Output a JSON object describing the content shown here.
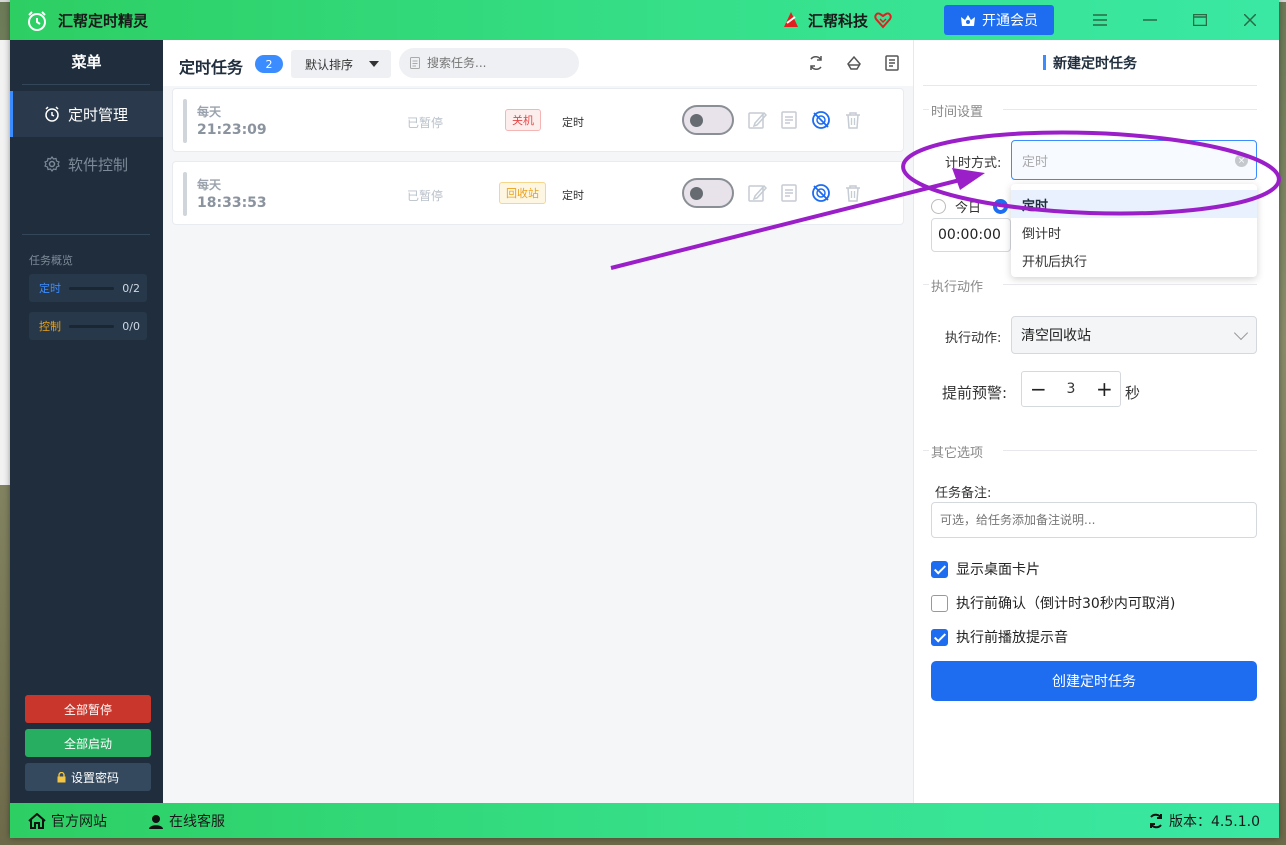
{
  "app": {
    "title": "汇帮定时精灵",
    "brand": "汇帮科技",
    "vip_button": "开通会员"
  },
  "sidebar": {
    "menu_title": "菜单",
    "items": [
      {
        "label": "定时管理",
        "icon": "alarm-clock-icon",
        "active": true
      },
      {
        "label": "软件控制",
        "icon": "gear-icon",
        "active": false
      }
    ],
    "overview_title": "任务概览",
    "overview": [
      {
        "label": "定时",
        "count": "0/2",
        "color": "#3b8cff"
      },
      {
        "label": "控制",
        "count": "0/0",
        "color": "#e9a11a"
      }
    ],
    "buttons": {
      "pause_all": "全部暂停",
      "start_all": "全部启动",
      "set_password": "设置密码"
    }
  },
  "toolbar": {
    "title": "定时任务",
    "badge": "2",
    "sort": "默认排序",
    "search_placeholder": "搜索任务..."
  },
  "tasks": [
    {
      "freq": "每天",
      "time": "21:23:09",
      "state": "已暂停",
      "tag": "关机",
      "tag_color": "red",
      "mode": "定时",
      "enabled": false
    },
    {
      "freq": "每天",
      "time": "18:33:53",
      "state": "已暂停",
      "tag": "回收站",
      "tag_color": "yellow",
      "mode": "定时",
      "enabled": false
    }
  ],
  "form": {
    "title": "新建定时任务",
    "section_time": "时间设置",
    "timing_label": "计时方式:",
    "timing_value": "定时",
    "timing_options": [
      "定时",
      "倒计时",
      "开机后执行"
    ],
    "radio_label": "今日",
    "time_value": "00:00:00",
    "section_action": "执行动作",
    "action_label": "执行动作:",
    "action_value": "清空回收站",
    "warn_label": "提前预警:",
    "warn_value": "3",
    "warn_unit": "秒",
    "warn_minus": "−",
    "warn_plus": "+",
    "section_other": "其它选项",
    "note_label": "任务备注:",
    "note_placeholder": "可选，给任务添加备注说明...",
    "checkboxes": [
      {
        "label": "显示桌面卡片",
        "checked": true
      },
      {
        "label": "执行前确认（倒计时30秒内可取消)",
        "checked": false
      },
      {
        "label": "执行前播放提示音",
        "checked": true
      }
    ],
    "submit": "创建定时任务"
  },
  "statusbar": {
    "website": "官方网站",
    "support": "在线客服",
    "version": "版本：4.5.1.0"
  },
  "colors": {
    "accent": "#1e6df0",
    "titlebar": "#36e08a",
    "sidebar": "#1f2d3d",
    "annotation": "#9b1fc9"
  }
}
